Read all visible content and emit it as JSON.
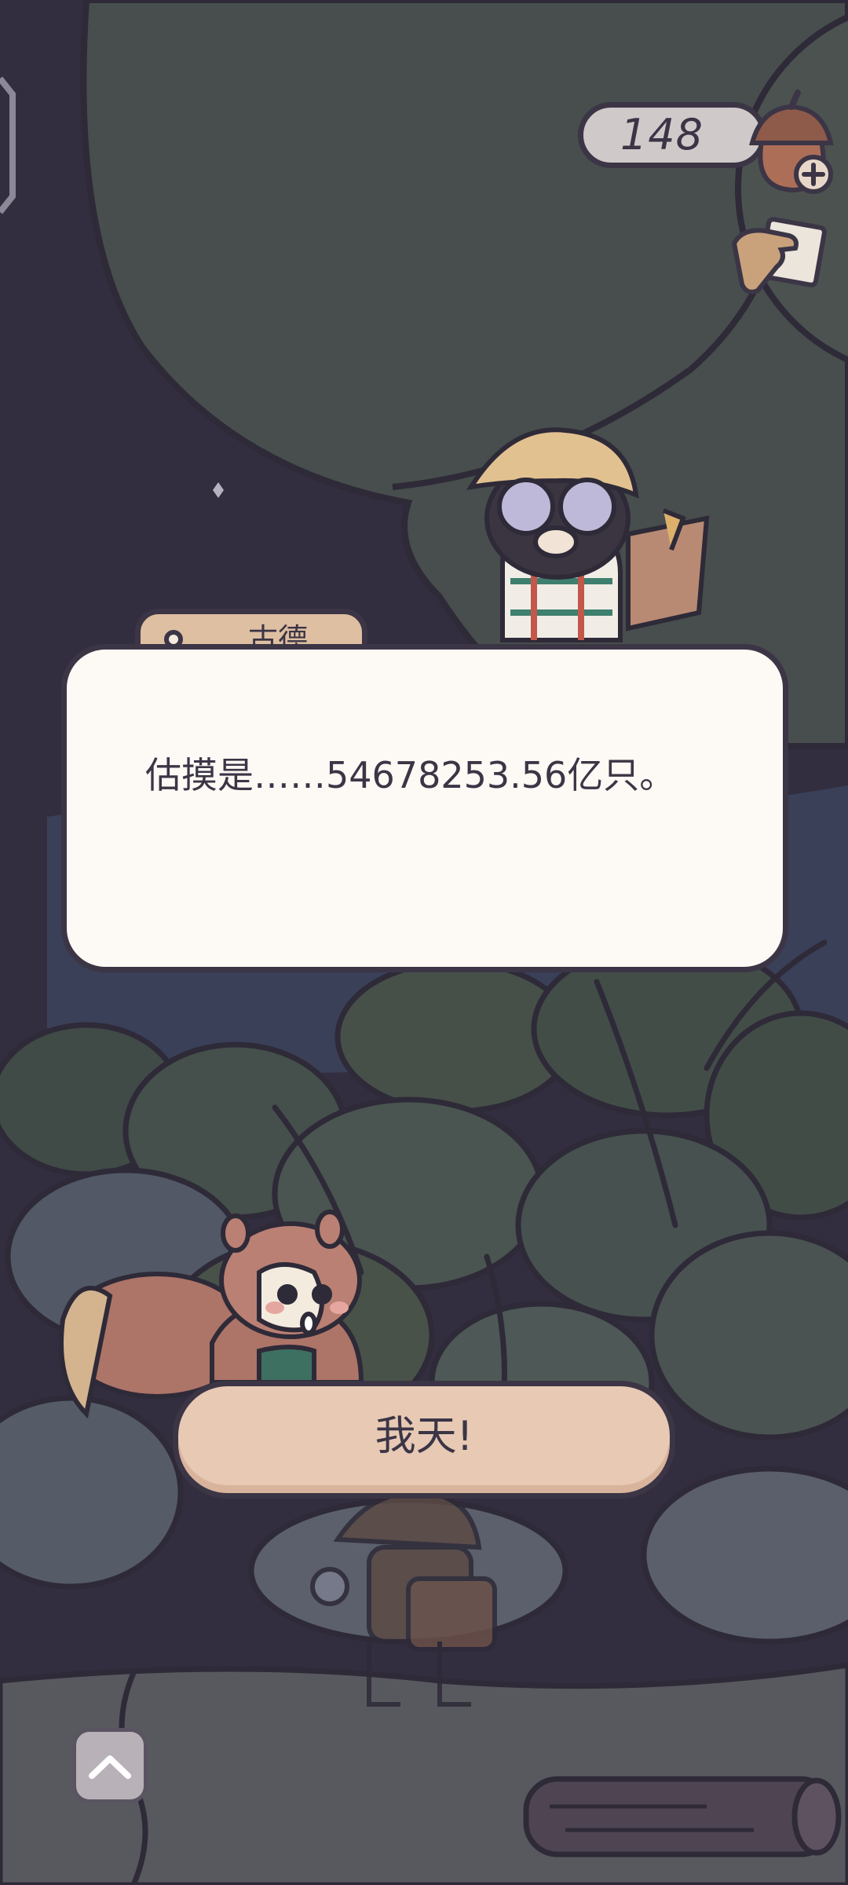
{
  "hud": {
    "acorn_count": "148"
  },
  "dialogue": {
    "speaker": "古德",
    "text": "估摸是……54678253.56亿只。"
  },
  "reply": {
    "label": "我天!"
  },
  "icons": {
    "currency": "acorn-icon",
    "add": "plus-icon",
    "hand": "hand-icon",
    "expand": "chevron-up-icon"
  }
}
